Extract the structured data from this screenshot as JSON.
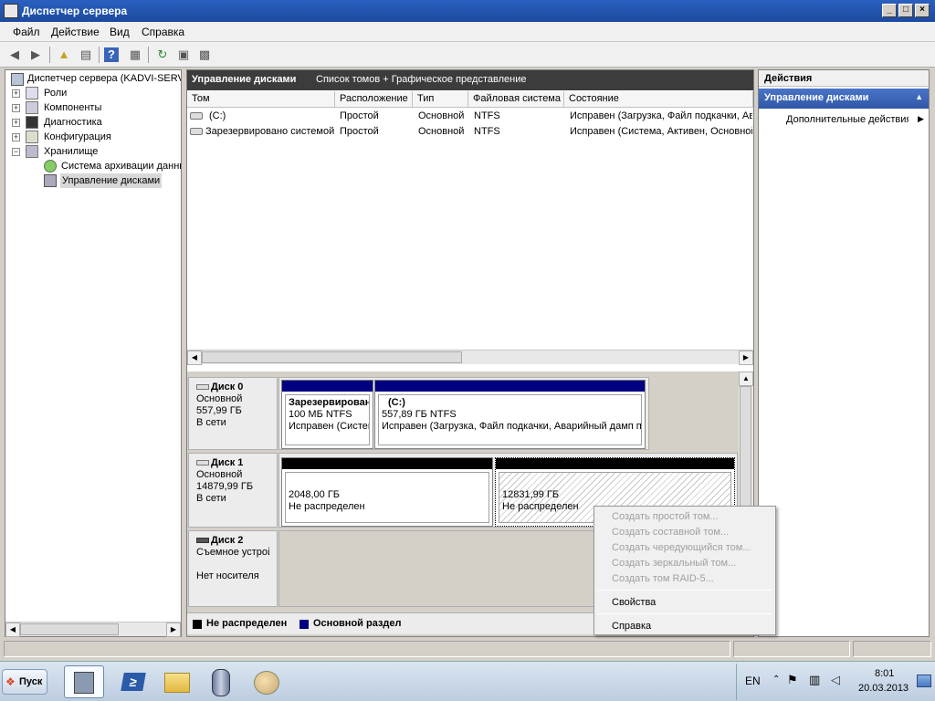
{
  "window": {
    "title": "Диспетчер сервера"
  },
  "menu": [
    "Файл",
    "Действие",
    "Вид",
    "Справка"
  ],
  "toolbar_icons": [
    "back-arrow-icon",
    "forward-arrow-icon",
    "up-folder-icon",
    "show-hide-tree-icon",
    "help-icon",
    "export-icon",
    "refresh-icon",
    "properties-icon",
    "snapin-icon"
  ],
  "tree": {
    "root": "Диспетчер сервера (KADVI-SERVER)",
    "items": [
      {
        "label": "Роли",
        "expander": "+"
      },
      {
        "label": "Компоненты",
        "expander": "+"
      },
      {
        "label": "Диагностика",
        "expander": "+"
      },
      {
        "label": "Конфигурация",
        "expander": "+"
      },
      {
        "label": "Хранилище",
        "expander": "−"
      }
    ],
    "storage_children": [
      {
        "label": "Система архивации данных"
      },
      {
        "label": "Управление дисками"
      }
    ]
  },
  "center": {
    "header_title": "Управление дисками",
    "header_view": "Список томов + Графическое представление",
    "columns": [
      "Том",
      "Расположение",
      "Тип",
      "Файловая система",
      "Состояние"
    ],
    "rows": [
      {
        "volume": "(C:)",
        "layout": "Простой",
        "type": "Основной",
        "fs": "NTFS",
        "status": "Исправен (Загрузка, Файл подкачки, Аварийный дамп памяти, Основной раздел)"
      },
      {
        "volume": "Зарезервировано системой",
        "layout": "Простой",
        "type": "Основной",
        "fs": "NTFS",
        "status": "Исправен (Система, Активен, Основной раздел)"
      }
    ]
  },
  "disks": [
    {
      "name": "Диск 0",
      "kind": "Основной",
      "size": "557,99 ГБ",
      "state": "В сети",
      "partitions": [
        {
          "title": "Зарезервировано системой",
          "size": "100 МБ NTFS",
          "status": "Исправен (Система, Активен, Основной раздел)"
        },
        {
          "title": "(C:)",
          "size": "557,89 ГБ NTFS",
          "status": "Исправен (Загрузка, Файл подкачки, Аварийный дамп памяти)"
        }
      ]
    },
    {
      "name": "Диск 1",
      "kind": "Основной",
      "size": "14879,99 ГБ",
      "state": "В сети",
      "partitions": [
        {
          "size": "2048,00 ГБ",
          "status": "Не распределен"
        },
        {
          "size": "12831,99 ГБ",
          "status": "Не распределен"
        }
      ]
    },
    {
      "name": "Диск 2",
      "kind": "Съемное устройство",
      "state": "Нет носителя"
    }
  ],
  "legend": [
    {
      "label": "Не распределен",
      "color": "#000000"
    },
    {
      "label": "Основной раздел",
      "color": "#000080"
    }
  ],
  "actions": {
    "title": "Действия",
    "section": "Управление дисками",
    "more": "Дополнительные действия"
  },
  "context_menu": {
    "disabled_items": [
      "Создать простой том...",
      "Создать составной том...",
      "Создать чередующийся том...",
      "Создать зеркальный том...",
      "Создать том RAID-5..."
    ],
    "properties": "Свойства",
    "help": "Справка"
  },
  "taskbar": {
    "start": "Пуск",
    "lang": "EN",
    "time": "8:01",
    "date": "20.03.2013"
  },
  "colors": {
    "primary_partition": "#000080",
    "unallocated": "#000000",
    "actions_header": "#3a64b8"
  }
}
